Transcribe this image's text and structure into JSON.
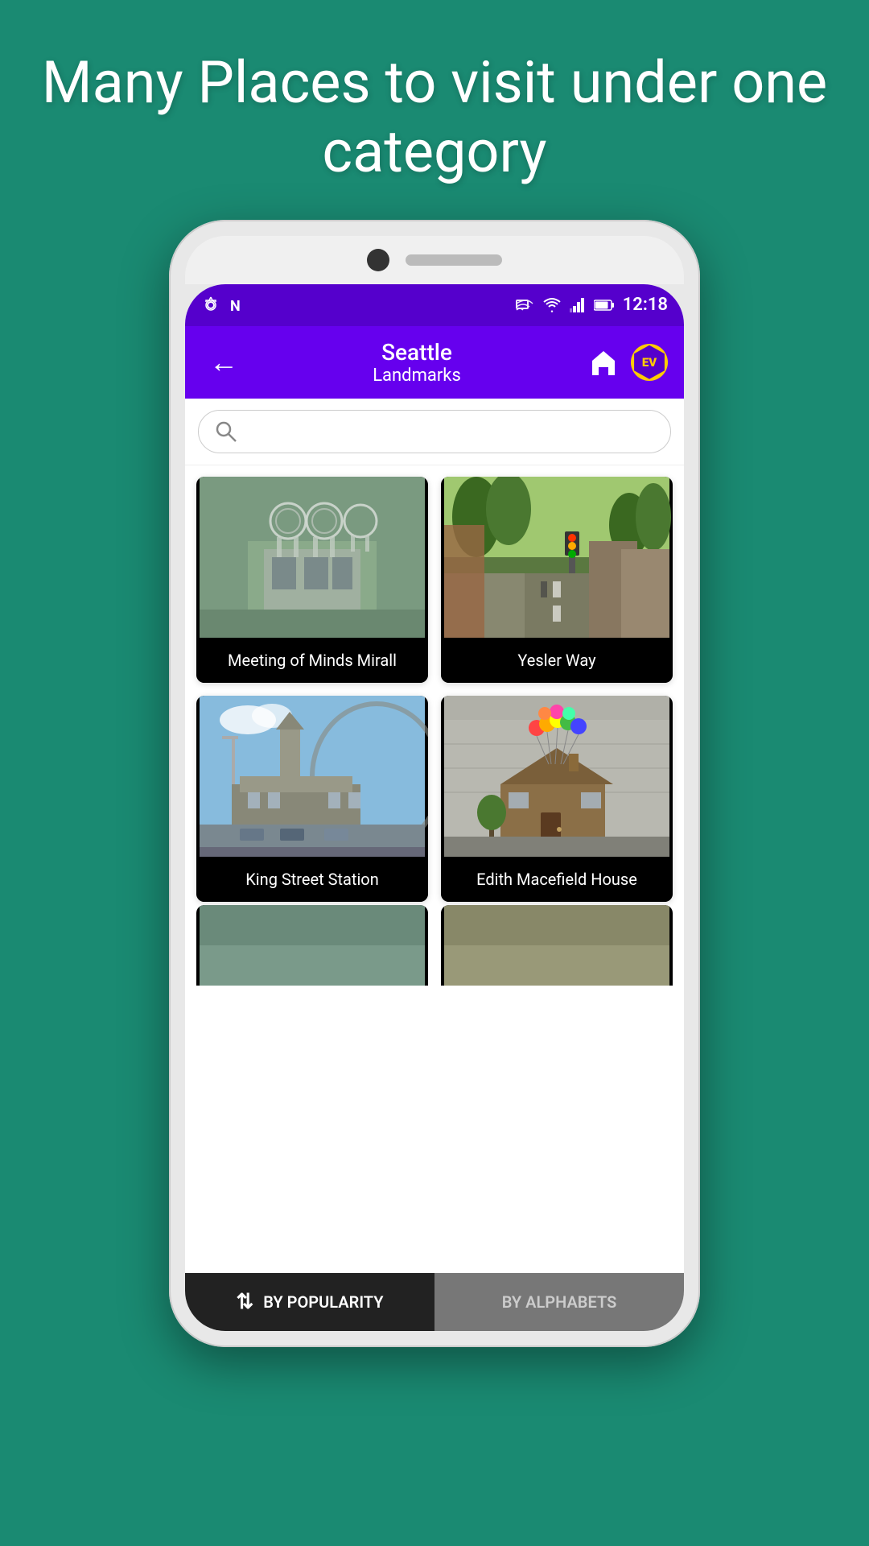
{
  "page": {
    "background_color": "#1a8a72",
    "title": "Many Places to visit under one category"
  },
  "status_bar": {
    "time": "12:18",
    "icons": [
      "cast",
      "wifi",
      "signal",
      "battery"
    ]
  },
  "app_bar": {
    "back_label": "←",
    "city": "Seattle",
    "category": "Landmarks",
    "home_label": "🏠",
    "badge_label": "EV"
  },
  "search": {
    "placeholder": ""
  },
  "cards": [
    {
      "id": "meeting-minds",
      "label": "Meeting of Minds Mirall",
      "image_description": "metallic sculpture"
    },
    {
      "id": "yesler-way",
      "label": "Yesler Way",
      "image_description": "street scene"
    },
    {
      "id": "king-street",
      "label": "King Street Station",
      "image_description": "train station building"
    },
    {
      "id": "edith-macefield",
      "label": "Edith Macefield House",
      "image_description": "small house with balloons"
    }
  ],
  "bottom_bar": {
    "sort_icon": "⇅",
    "left_label": "BY POPULARITY",
    "right_label": "BY ALPHABETS"
  }
}
